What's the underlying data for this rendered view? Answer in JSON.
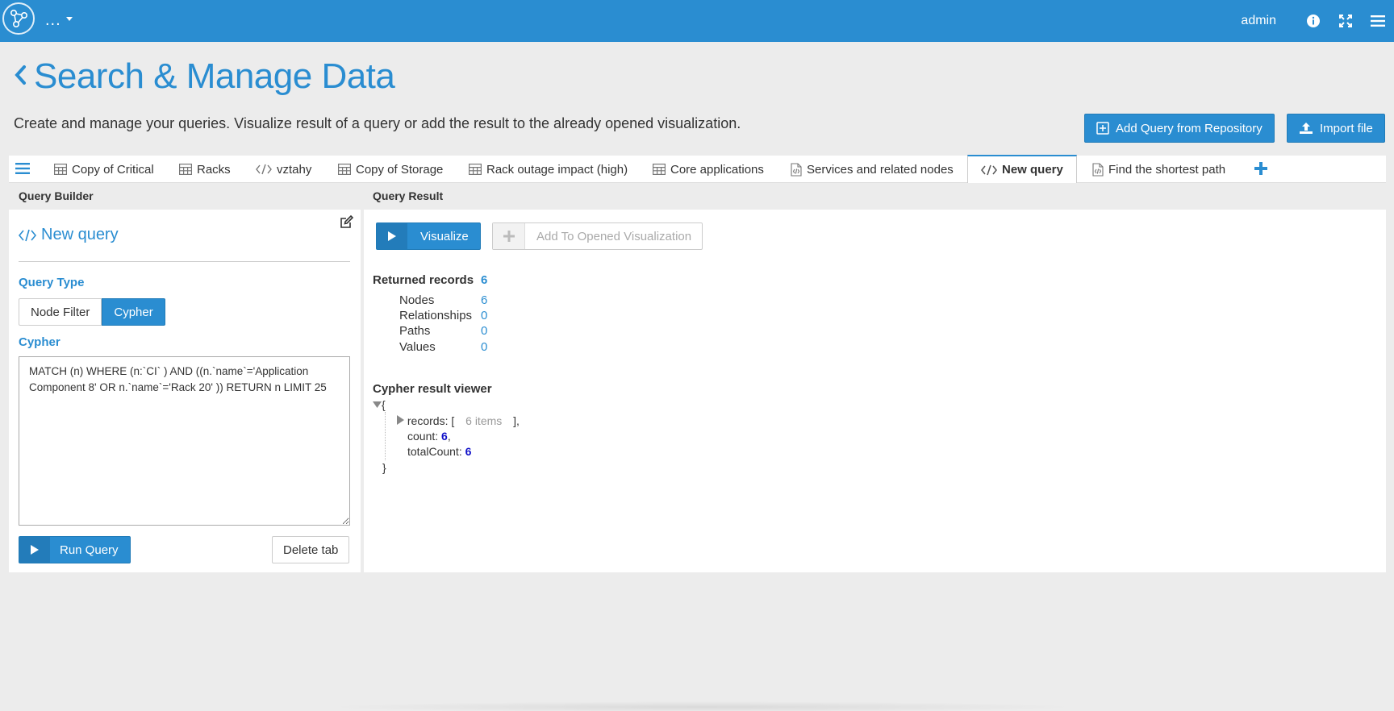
{
  "topbar": {
    "brand_menu": "...",
    "user": "admin",
    "icons": [
      "info-icon",
      "fullscreen-icon",
      "hamburger-menu-icon"
    ]
  },
  "page": {
    "title": "Search & Manage Data",
    "description": "Create and manage your queries. Visualize result of a query or add the result to the already opened visualization.",
    "add_query_label": "Add Query from Repository",
    "import_label": "Import file"
  },
  "tabs": [
    {
      "label": "Copy of Critical",
      "icon": "table-icon"
    },
    {
      "label": "Racks",
      "icon": "table-icon"
    },
    {
      "label": "vztahy",
      "icon": "code-icon"
    },
    {
      "label": "Copy of Storage",
      "icon": "table-icon"
    },
    {
      "label": "Rack outage impact (high)",
      "icon": "table-icon"
    },
    {
      "label": "Core applications",
      "icon": "table-icon"
    },
    {
      "label": "Services and related nodes",
      "icon": "code-file-icon"
    },
    {
      "label": "New query",
      "icon": "code-icon",
      "active": true
    },
    {
      "label": "Find the shortest path",
      "icon": "code-file-icon"
    }
  ],
  "query_builder": {
    "header": "Query Builder",
    "name": "New query",
    "query_type_label": "Query Type",
    "types": [
      "Node Filter",
      "Cypher"
    ],
    "selected_type": "Cypher",
    "cypher_label": "Cypher",
    "cypher_text": "MATCH (n) WHERE (n:`CI` ) AND ((n.`name`='Application Component 8' OR n.`name`='Rack 20' )) RETURN n LIMIT 25",
    "run_label": "Run Query",
    "delete_label": "Delete tab"
  },
  "query_result": {
    "header": "Query Result",
    "visualize_label": "Visualize",
    "add_visualization_label": "Add To Opened Visualization",
    "returned_records_label": "Returned records",
    "returned_records": "6",
    "breakdown": [
      {
        "label": "Nodes",
        "value": "6"
      },
      {
        "label": "Relationships",
        "value": "0"
      },
      {
        "label": "Paths",
        "value": "0"
      },
      {
        "label": "Values",
        "value": "0"
      }
    ],
    "viewer_title": "Cypher result viewer",
    "viewer": {
      "open_brace": "{",
      "close_brace": "}",
      "records_key": "records: [",
      "records_count": "6 items",
      "records_close": "],",
      "count_key": "count: ",
      "count_val": "6",
      "count_tail": ",",
      "total_key": "totalCount: ",
      "total_val": "6"
    }
  },
  "colors": {
    "accent": "#2a8dd1",
    "background": "#ececec"
  }
}
